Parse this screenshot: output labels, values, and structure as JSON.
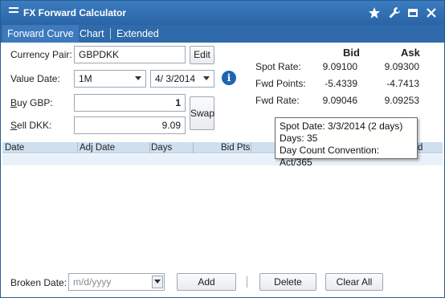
{
  "window": {
    "title": "FX Forward Calculator"
  },
  "tabs": [
    {
      "label": "Forward Curve"
    },
    {
      "label": "Chart"
    },
    {
      "label": "Extended"
    }
  ],
  "form": {
    "currency_pair_label": "Currency Pair:",
    "currency_pair_value": "GBPDKK",
    "edit_label": "Edit",
    "value_date_label": "Value Date:",
    "tenor_value": "1M",
    "date_value": "4/  3/2014",
    "buy_label_key": "B",
    "buy_label_rest": "uy GBP:",
    "buy_value": "1",
    "sell_label_key": "S",
    "sell_label_rest": "ell DKK:",
    "sell_value": "9.09",
    "swap_label": "Swap"
  },
  "rates": {
    "bid_header": "Bid",
    "ask_header": "Ask",
    "rows": [
      {
        "label": "Spot Rate:",
        "bid": "9.09100",
        "ask": "9.09300"
      },
      {
        "label": "Fwd Points:",
        "bid": "-5.4339",
        "ask": "-4.7413"
      },
      {
        "label": "Fwd Rate:",
        "bid": "9.09046",
        "ask": "9.09253"
      }
    ]
  },
  "tooltip": {
    "line1": "Spot Date: 3/3/2014 (2 days)",
    "line2": "Days: 35",
    "line3": "Day Count Convention: Act/365"
  },
  "grid": {
    "columns": [
      "Date",
      "Adj Date",
      "Days",
      "Bid Pts"
    ],
    "hidden_tail": "d"
  },
  "footer": {
    "broken_date_label": "Broken Date:",
    "broken_date_placeholder": "m/d/yyyy",
    "add_label": "Add",
    "delete_label": "Delete",
    "clear_all_label": "Clear All"
  },
  "colors": {
    "titlebar": "#2a64a6",
    "tabbar": "#2f6aab",
    "grid_header": "#cfdff0",
    "info": "#1f64b4"
  }
}
